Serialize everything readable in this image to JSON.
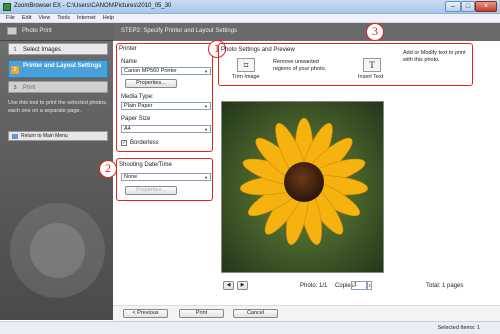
{
  "window": {
    "title": "ZoomBrowser EX - C:\\Users\\CANON\\Pictures\\2010_05_30",
    "min": "–",
    "max": "□",
    "close": "×"
  },
  "menu": [
    "File",
    "Edit",
    "View",
    "Tools",
    "Internet",
    "Help"
  ],
  "sidebar": {
    "header": "Photo Print",
    "steps": [
      {
        "num": "1",
        "label": "Select Images"
      },
      {
        "num": "2",
        "label": "Printer and Layout Settings"
      },
      {
        "num": "3",
        "label": "Print"
      }
    ],
    "description": "Use this tool to print the selected photos, each one on a separate page.",
    "return_label": "Return to Main Menu"
  },
  "main": {
    "header": "STEP2: Specify Printer and Layout Settings",
    "printer": {
      "title": "Printer",
      "name_label": "Name",
      "name_value": "Canon MP560 Printer",
      "properties_label": "Properties...",
      "media_label": "Media Type:",
      "media_value": "Plain Paper",
      "paper_label": "Paper Size",
      "paper_value": "A4",
      "borderless_label": "Borderless",
      "borderless_checked": "✓"
    },
    "shooting": {
      "title": "Shooting Date/Time",
      "value": "None",
      "properties_label": "Properties..."
    },
    "photo_settings": {
      "title": "Photo Settings and Preview",
      "trim_desc": "Remove unwanted regions of your photo.",
      "trim_label": "Trim Image",
      "text_desc": "Add or Modify text to print with this photo.",
      "text_label": "Insert Text"
    },
    "nav": {
      "prev": "◀",
      "next": "▶",
      "photo_count": "Photo: 1/1",
      "copies_label": "Copies:",
      "copies_value": "1",
      "total": "Total: 1 pages"
    },
    "callouts": [
      "1",
      "2",
      "3"
    ]
  },
  "bottom": {
    "previous": "< Previous",
    "print": "Print",
    "cancel": "Cancel"
  },
  "status": {
    "selected": "Selected Items: 1"
  },
  "colors": {
    "accent": "#4aa0d8",
    "callout_red": "#e1261c",
    "sidebar_bg": "#585858"
  }
}
